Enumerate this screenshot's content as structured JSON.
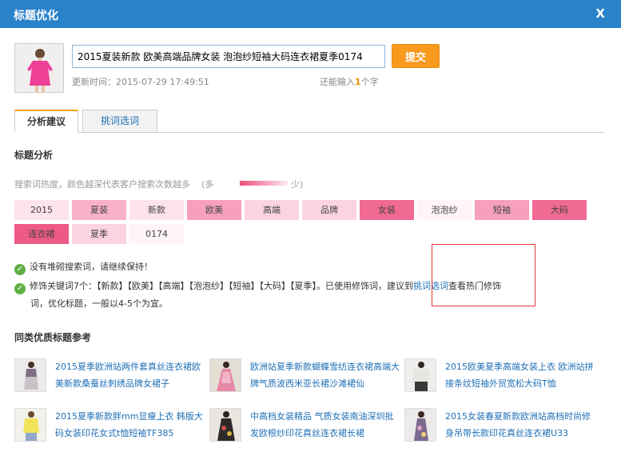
{
  "dialog": {
    "title": "标题优化",
    "close": "X"
  },
  "product": {
    "title_value": "2015夏装新款 欧美高端品牌女装 泡泡纱短袖大码连衣裙夏季0174",
    "submit_label": "提交",
    "updated_label": "更新时间：2015-07-29 17:49:51",
    "remaining_prefix": "还能输入",
    "remaining_count": "1",
    "remaining_suffix": "个字"
  },
  "tabs": [
    {
      "label": "分析建议",
      "active": true
    },
    {
      "label": "挑词选词",
      "active": false
    }
  ],
  "analysis": {
    "heading": "标题分析",
    "legend_text": "搜索词热度，颜色越深代表客户搜索次数越多",
    "legend_more": "(多",
    "legend_less": "少)",
    "keywords": [
      {
        "text": "2015",
        "color": "#fde3ec"
      },
      {
        "text": "夏装",
        "color": "#f8b1c7"
      },
      {
        "text": "新款",
        "color": "#fde3ec"
      },
      {
        "text": "欧美",
        "color": "#f6a0bd"
      },
      {
        "text": "高端",
        "color": "#fcd3e1"
      },
      {
        "text": "品牌",
        "color": "#fcd3e1"
      },
      {
        "text": "女装",
        "color": "#f06a92"
      },
      {
        "text": "泡泡纱",
        "color": "#fff4f7"
      },
      {
        "text": "短袖",
        "color": "#f6a0bd"
      },
      {
        "text": "大码",
        "color": "#f06a92"
      },
      {
        "text": "连衣裙",
        "color": "#ee5a86"
      },
      {
        "text": "夏季",
        "color": "#fcd3e1"
      },
      {
        "text": "0174",
        "color": "#fff4f7"
      }
    ],
    "msg1": "没有堆砌搜索词，请继续保持！",
    "msg2_prefix": "修饰关键词7个：【新款】【欧美】【高端】【泡泡纱】【短袖】【大码】【夏季】。已使用修饰词，建议到",
    "msg2_link": "挑词选词",
    "msg2_mid": "查看热门修饰",
    "msg2_line2": "词，优化标题，一般以4-5个为宜。"
  },
  "reference": {
    "heading": "同类优质标题参考",
    "items": [
      {
        "text": "2015夏季欧洲站两件套真丝连衣裙欧美新款桑蚕丝刺绣品牌女裙子"
      },
      {
        "text": "欧洲站夏季新款蝴蝶雪纺连衣裙高端大牌气质波西米亚长裙沙滩裙仙"
      },
      {
        "text": "2015欧美夏季高端女装上衣 欧洲站拼接条纹短袖外贸宽松大码T恤"
      },
      {
        "text": "2015夏季新款胖mm显瘦上衣 韩版大码女装印花女式t恤短袖TF385"
      },
      {
        "text": "中高档女装精品 气质女装南油深圳批发欧根纱印花真丝连衣裙长裙"
      },
      {
        "text": "2015女装春夏新款欧洲站高档时尚修身吊带长款印花真丝连衣裙U33"
      }
    ]
  },
  "colors": {
    "titlebar": "#2a82c9",
    "accent": "#f79a1e",
    "link": "#1f6fb5"
  }
}
